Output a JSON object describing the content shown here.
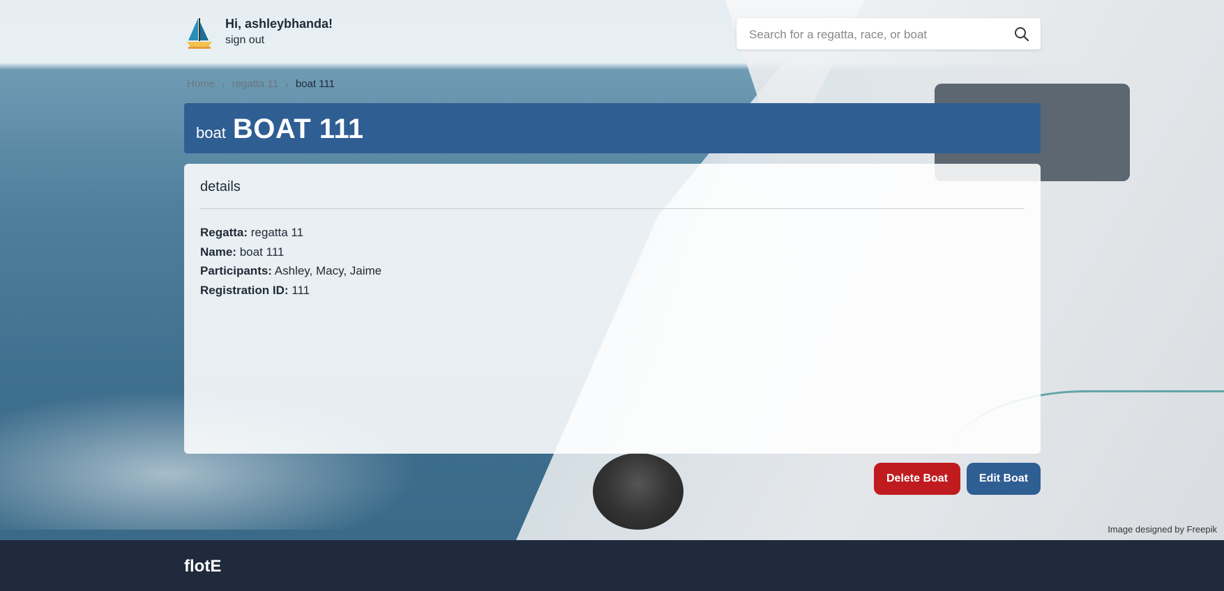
{
  "header": {
    "greeting": "Hi, ashleybhanda!",
    "signout": "sign out"
  },
  "search": {
    "placeholder": "Search for a regatta, race, or boat",
    "value": ""
  },
  "breadcrumb": {
    "items": [
      "Home",
      "regatta 11",
      "boat 111"
    ]
  },
  "title": {
    "kind": "boat",
    "name": "BOAT 111"
  },
  "details": {
    "heading": "details",
    "rows": [
      {
        "label": "Regatta:",
        "value": "regatta 11"
      },
      {
        "label": "Name:",
        "value": "boat 111"
      },
      {
        "label": "Participants:",
        "value": "Ashley, Macy, Jaime"
      },
      {
        "label": "Registration ID:",
        "value": "111"
      }
    ]
  },
  "actions": {
    "delete": "Delete Boat",
    "edit": "Edit Boat"
  },
  "credit": "Image designed by Freepik",
  "footer": {
    "brand": "flotE"
  },
  "colors": {
    "primary": "#2f5e93",
    "danger": "#c01c1f",
    "footer": "#1f2a3c"
  },
  "icons": {
    "logo": "sailboat-icon",
    "search": "search-icon",
    "separator": "chevron-right-icon"
  }
}
